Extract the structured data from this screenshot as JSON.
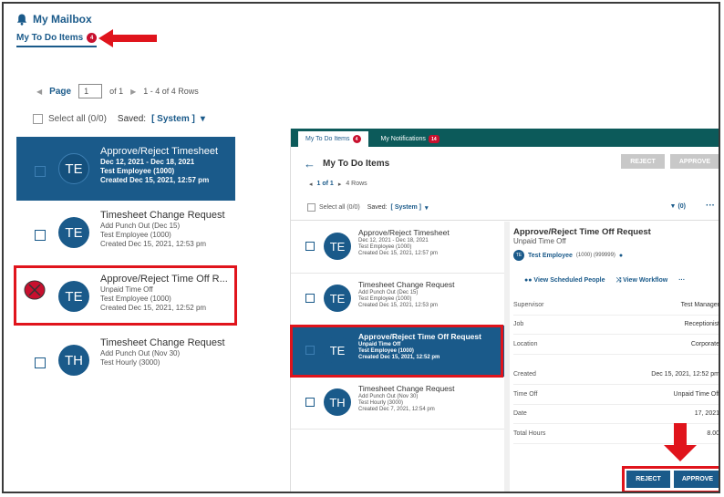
{
  "left": {
    "title": "My Mailbox",
    "tab_label": "My To Do Items",
    "tab_badge": "4",
    "pager": {
      "page_label": "Page",
      "page_value": "1",
      "of_label": "of 1",
      "rows_label": "1 - 4 of 4 Rows"
    },
    "select_all": "Select all (0/0)",
    "saved_label": "Saved:",
    "saved_value": "[ System ]",
    "items": [
      {
        "initials": "TE",
        "title": "Approve/Reject Timesheet",
        "l1": "Dec 12, 2021 - Dec 18, 2021",
        "l2": "Test Employee (1000)",
        "l3": "Created Dec 15, 2021, 12:57 pm"
      },
      {
        "initials": "TE",
        "title": "Timesheet Change Request",
        "l1": "Add Punch Out (Dec 15)",
        "l2": "Test Employee (1000)",
        "l3": "Created Dec 15, 2021, 12:53 pm"
      },
      {
        "initials": "TE",
        "title": "Approve/Reject Time Off R...",
        "l1": "Unpaid Time Off",
        "l2": "Test Employee (1000)",
        "l3": "Created Dec 15, 2021, 12:52 pm"
      },
      {
        "initials": "TH",
        "title": "Timesheet Change Request",
        "l1": "Add Punch Out (Nov 30)",
        "l2": "Test Hourly (3000)",
        "l3": ""
      }
    ]
  },
  "right": {
    "tabs": [
      {
        "label": "My To Do Items",
        "badge": "4"
      },
      {
        "label": "My Notifications",
        "badge": "14"
      }
    ],
    "title": "My To Do Items",
    "reject_label": "REJECT",
    "approve_label": "APPROVE",
    "pager_label": "1 of 1",
    "rows_label": "4 Rows",
    "select_all": "Select all (0/0)",
    "saved_label": "Saved:",
    "saved_value": "[ System ]",
    "filter_label": "(0)",
    "items": [
      {
        "initials": "TE",
        "title": "Approve/Reject Timesheet",
        "l1": "Dec 12, 2021 - Dec 18, 2021",
        "l2": "Test Employee (1000)",
        "l3": "Created Dec 15, 2021, 12:57 pm"
      },
      {
        "initials": "TE",
        "title": "Timesheet Change Request",
        "l1": "Add Punch Out (Dec 15)",
        "l2": "Test Employee (1000)",
        "l3": "Created Dec 15, 2021, 12:53 pm"
      },
      {
        "initials": "TE",
        "title": "Approve/Reject Time Off Request",
        "l1": "Unpaid Time Off",
        "l2": "Test Employee (1000)",
        "l3": "Created Dec 15, 2021, 12:52 pm"
      },
      {
        "initials": "TH",
        "title": "Timesheet Change Request",
        "l1": "Add Punch Out (Nov 30)",
        "l2": "Test Hourly (3000)",
        "l3": "Created Dec 7, 2021, 12:54 pm"
      }
    ],
    "detail": {
      "title": "Approve/Reject Time Off Request",
      "subtitle": "Unpaid Time Off",
      "emp_initials": "TE",
      "emp_name": "Test Employee",
      "emp_id": "(1000) (999999)",
      "link1": "View Scheduled People",
      "link2": "View Workflow",
      "rows1": [
        {
          "label": "Supervisor",
          "value": "Test Manager"
        },
        {
          "label": "Job",
          "value": "Receptionist"
        },
        {
          "label": "Location",
          "value": "Corporate"
        }
      ],
      "rows2": [
        {
          "label": "Created",
          "value": "Dec 15, 2021, 12:52 pm"
        },
        {
          "label": "Time Off",
          "value": "Unpaid Time Off"
        },
        {
          "label": "Date",
          "value": "17, 2021"
        },
        {
          "label": "Total Hours",
          "value": "8.00"
        }
      ]
    }
  }
}
